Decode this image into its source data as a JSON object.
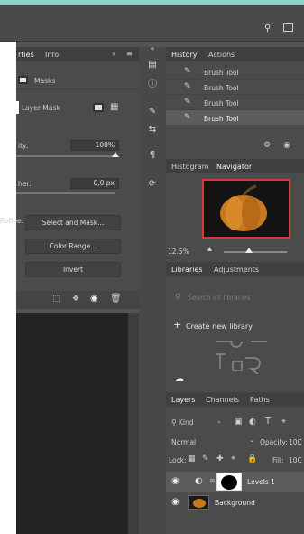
{
  "properties_panel": {
    "tabs": [
      "rties",
      "Info"
    ],
    "masks_label": "Masks",
    "layer_mask_label": "Layer Mask",
    "density_label": "ity:",
    "density_value": "100%",
    "feather_label": "her:",
    "feather_value": "0,0 px",
    "refine_label": "Refine:",
    "buttons": [
      "Select and Mask...",
      "Color Range...",
      "Invert"
    ]
  },
  "history_panel": {
    "tabs": [
      "History",
      "Actions"
    ],
    "items": [
      "Brush Tool",
      "Brush Tool",
      "Brush Tool",
      "Brush Tool"
    ]
  },
  "navigator_panel": {
    "tabs": [
      "Histogram",
      "Navigator"
    ],
    "zoom": "12.5%"
  },
  "libraries_panel": {
    "tabs": [
      "Libraries",
      "Adjustments"
    ],
    "search_placeholder": "Search all libraries",
    "create_label": "Create new library"
  },
  "layers_panel": {
    "tabs": [
      "Layers",
      "Channels",
      "Paths"
    ],
    "filter_kind": "Kind",
    "blend_mode": "Normal",
    "opacity_label": "Opacity:",
    "opacity_value": "10C",
    "lock_label": "Lock:",
    "fill_label": "Fill:",
    "fill_value": "10C",
    "layers": [
      {
        "name": "Levels 1"
      },
      {
        "name": "Background"
      }
    ]
  },
  "colors": {
    "accent_top": "#8fd3c5",
    "panel_bg": "#4b4b4b",
    "header_bg": "#404040"
  }
}
